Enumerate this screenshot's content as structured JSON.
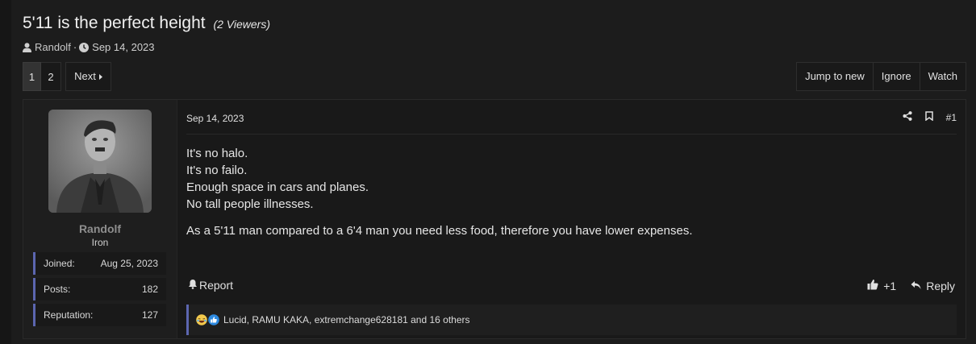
{
  "thread": {
    "title": "5'11 is the perfect height",
    "viewers": "(2 Viewers)",
    "author": "Randolf",
    "separator": "·",
    "date": "Sep 14, 2023"
  },
  "pagination": {
    "pages": [
      "1",
      "2"
    ],
    "current": "1",
    "next_label": "Next"
  },
  "thread_actions": {
    "jump_label": "Jump to new",
    "ignore_label": "Ignore",
    "watch_label": "Watch"
  },
  "post": {
    "user": {
      "name": "Randolf",
      "title": "Iron",
      "stats": [
        {
          "label": "Joined:",
          "value": "Aug 25, 2023"
        },
        {
          "label": "Posts:",
          "value": "182"
        },
        {
          "label": "Reputation:",
          "value": "127"
        }
      ]
    },
    "date": "Sep 14, 2023",
    "number": "#1",
    "lines": [
      "It's no halo.",
      "It's no failo.",
      "Enough space in cars and planes.",
      "No tall people illnesses."
    ],
    "paragraph2": "As a 5'11 man compared to a 6'4 man you need less food, therefore you have lower expenses.",
    "report_label": "Report",
    "like_label": "+1",
    "reply_label": "Reply",
    "reactions_text": "Lucid, RAMU KAKA, extremchange628181 and 16 others"
  },
  "colors": {
    "accent_blue": "#5c66b0",
    "background": "#1c1c1c",
    "panel": "#191919"
  },
  "icons": [
    "user-icon",
    "clock-icon",
    "share-icon",
    "bookmark-icon",
    "bell-icon",
    "thumbs-up-icon",
    "reply-icon",
    "laughing-emoji-icon",
    "like-emoji-icon",
    "caret-right-icon"
  ]
}
